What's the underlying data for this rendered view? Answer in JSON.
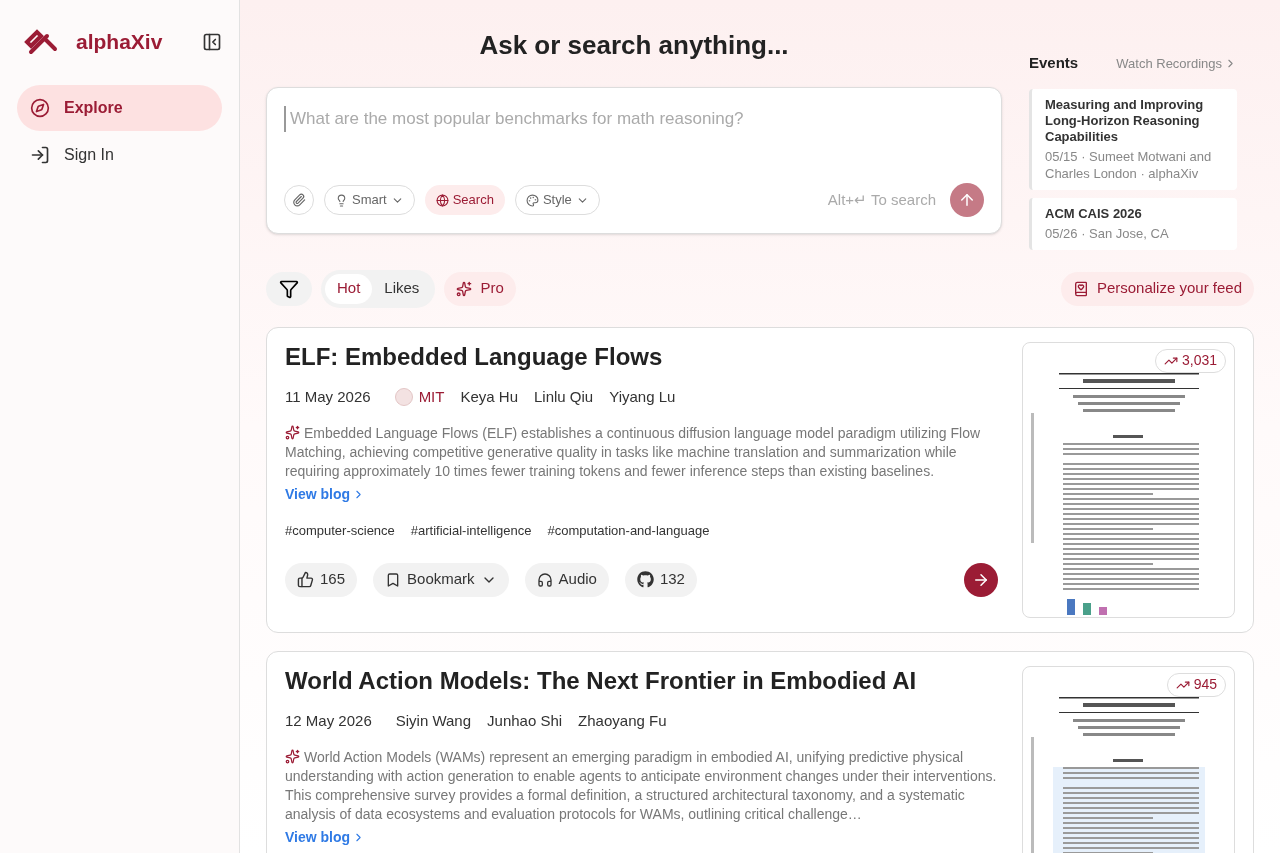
{
  "sidebar": {
    "brand": "alphaXiv",
    "items": [
      {
        "kind": "explore",
        "label": "Explore",
        "selected": true
      },
      {
        "kind": "signin",
        "label": "Sign In",
        "selected": false
      }
    ]
  },
  "search": {
    "title": "Ask or search anything...",
    "placeholder": "What are the most popular benchmarks for math reasoning?",
    "tools": [
      {
        "kind": "attach",
        "selected": false
      },
      {
        "kind": "smart",
        "label": "Smart",
        "selected": false
      },
      {
        "kind": "search",
        "label": "Search",
        "selected": true
      },
      {
        "kind": "style",
        "label": "Style",
        "selected": false
      }
    ],
    "hint": "Alt+↵ To search"
  },
  "events": {
    "title": "Events",
    "link": "Watch Recordings",
    "items": [
      {
        "title": "Measuring and Improving Long-Horizon Reasoning Capabilities",
        "meta": "05/15 · Sumeet Motwani and Charles London · alphaXiv"
      },
      {
        "title": "ACM CAIS 2026",
        "meta": "05/26 · San Jose, CA"
      }
    ]
  },
  "feed": {
    "sort": [
      {
        "label": "Hot",
        "selected": true
      },
      {
        "label": "Likes",
        "selected": false
      }
    ],
    "pro": "Pro",
    "personalize": "Personalize your feed"
  },
  "papers": [
    {
      "title": "ELF: Embedded Language Flows",
      "date": "11 May 2026",
      "org": "MIT",
      "authors": [
        "Keya Hu",
        "Linlu Qiu",
        "Yiyang Lu"
      ],
      "summary": "Embedded Language Flows (ELF) establishes a continuous diffusion language model paradigm utilizing Flow Matching, achieving competitive generative quality in tasks like machine translation and summarization while requiring approximately 10 times fewer training tokens and fewer inference steps than existing baselines.",
      "link": "View blog",
      "views": "3,031",
      "kind": "plain",
      "tags": [
        "#computer-science",
        "#artificial-intelligence",
        "#computation-and-language"
      ],
      "likes": "165",
      "bookmark": "Bookmark",
      "audio": "Audio",
      "github": "132"
    },
    {
      "title": "World Action Models: The Next Frontier in Embodied AI",
      "date": "12 May 2026",
      "authors": [
        "Siyin Wang",
        "Junhao Shi",
        "Zhaoyang Fu"
      ],
      "summary": "World Action Models (WAMs) represent an emerging paradigm in embodied AI, unifying predictive physical understanding with action generation to enable agents to anticipate environment changes under their interventions. This comprehensive survey provides a formal definition, a structured architectural taxonomy, and a systematic analysis of data ecosystems and evaluation protocols for WAMs, outlining critical challenge…",
      "link": "View blog",
      "views": "945",
      "kind": "boxed"
    }
  ]
}
